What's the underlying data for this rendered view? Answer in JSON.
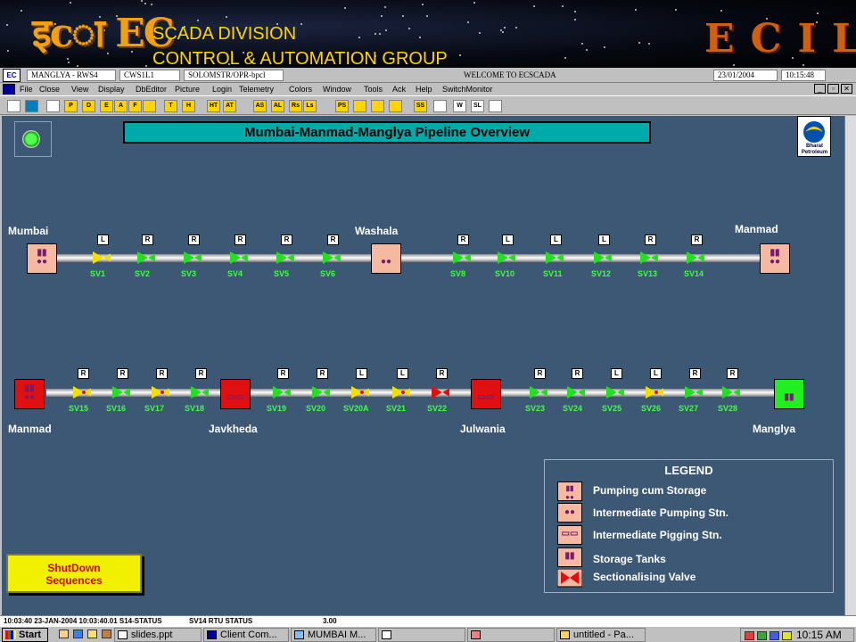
{
  "banner": {
    "logo_left": "इcा EC",
    "division_line1": "SCADA DIVISION",
    "division_line2": "CONTROL & AUTOMATION GROUP",
    "logo_right": "ECIL"
  },
  "titlebar": {
    "station": "MANGLYA - RWS4",
    "node": "CWS1L1",
    "user": "SOLOMSTR/OPR-bpcl",
    "welcome": "WELCOME TO ECSCADA",
    "date": "23/01/2004",
    "time": "10:15:48"
  },
  "menu": [
    "File",
    "Close",
    "View",
    "Display",
    "DbEditor",
    "Picture",
    "Login",
    "Telemetry",
    "Colors",
    "Window",
    "Tools",
    "Ack",
    "Help",
    "SwitchMonitor"
  ],
  "toolbar_labels": [
    "",
    "",
    "",
    "P",
    "D",
    "E",
    "A",
    "F",
    "",
    "T",
    "H",
    "HT",
    "AT",
    "AS",
    "AL",
    "Rs",
    "Ls",
    "PS",
    "",
    "",
    "",
    "SS",
    "",
    "W",
    "SL",
    ""
  ],
  "title": "Mumbai-Manmad-Manglya Pipeline Overview",
  "logo_bp": "Bharat Petroleum",
  "row1": {
    "stations": [
      "Mumbai",
      "Washala",
      "Manmad"
    ],
    "valves": [
      {
        "name": "SV1",
        "mode": "L",
        "state": "closed-yellow"
      },
      {
        "name": "SV2",
        "mode": "R",
        "state": "open"
      },
      {
        "name": "SV3",
        "mode": "R",
        "state": "open"
      },
      {
        "name": "SV4",
        "mode": "R",
        "state": "open"
      },
      {
        "name": "SV5",
        "mode": "R",
        "state": "open"
      },
      {
        "name": "SV6",
        "mode": "R",
        "state": "open"
      },
      {
        "name": "SV8",
        "mode": "R",
        "state": "open"
      },
      {
        "name": "SV10",
        "mode": "L",
        "state": "open"
      },
      {
        "name": "SV11",
        "mode": "L",
        "state": "open"
      },
      {
        "name": "SV12",
        "mode": "L",
        "state": "open"
      },
      {
        "name": "SV13",
        "mode": "R",
        "state": "open"
      },
      {
        "name": "SV14",
        "mode": "R",
        "state": "open"
      }
    ]
  },
  "row2": {
    "stations": [
      "Manmad",
      "Javkheda",
      "Julwania",
      "Manglya"
    ],
    "valves": [
      {
        "name": "SV15",
        "mode": "R",
        "state": "yellow"
      },
      {
        "name": "SV16",
        "mode": "R",
        "state": "open"
      },
      {
        "name": "SV17",
        "mode": "R",
        "state": "yellow"
      },
      {
        "name": "SV18",
        "mode": "R",
        "state": "open"
      },
      {
        "name": "SV19",
        "mode": "R",
        "state": "open"
      },
      {
        "name": "SV20",
        "mode": "R",
        "state": "open"
      },
      {
        "name": "SV20A",
        "mode": "L",
        "state": "yellow"
      },
      {
        "name": "SV21",
        "mode": "L",
        "state": "yellow"
      },
      {
        "name": "SV22",
        "mode": "R",
        "state": "red"
      },
      {
        "name": "SV23",
        "mode": "R",
        "state": "open"
      },
      {
        "name": "SV24",
        "mode": "R",
        "state": "open"
      },
      {
        "name": "SV25",
        "mode": "L",
        "state": "open"
      },
      {
        "name": "SV26",
        "mode": "L",
        "state": "yellow"
      },
      {
        "name": "SV27",
        "mode": "R",
        "state": "open"
      },
      {
        "name": "SV28",
        "mode": "R",
        "state": "open"
      }
    ]
  },
  "legend": {
    "title": "LEGEND",
    "items": [
      "Pumping cum Storage",
      "Intermediate Pumping Stn.",
      "Intermediate Pigging Stn.",
      "Storage Tanks",
      "Sectionalising Valve"
    ]
  },
  "shutdown": {
    "line1": "ShutDown",
    "line2": "Sequences"
  },
  "message": {
    "time": "10:03:40 23-JAN-2004 10:03:40.01 S14-STATUS",
    "point": "SV14 RTU STATUS",
    "value": "3.00"
  },
  "taskbar": {
    "start": "Start",
    "tasks": [
      "slides.ppt",
      "Client Com...",
      "MUMBAI M...",
      "",
      "untitled - Pa..."
    ],
    "clock": "10:15 AM"
  },
  "colors": {
    "canvas": "#3d5875",
    "valve_open": "#20e020",
    "valve_yellow": "#f0e000",
    "valve_red": "#e01010",
    "label_green": "#40ff40"
  }
}
